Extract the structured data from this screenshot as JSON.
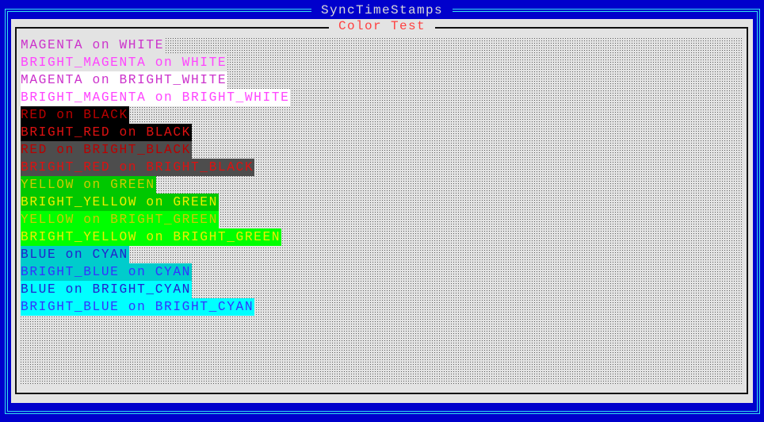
{
  "window": {
    "title": "SyncTimeStamps",
    "colors": {
      "background": "#0000CC",
      "border": "#33E0F0",
      "title_text": "#D8D8D8"
    }
  },
  "panel": {
    "title": "Color Test",
    "colors": {
      "background": "#E3E3E3",
      "frame": "#111111",
      "title_text": "#FF4040",
      "pattern_dot": "#5A5A5A"
    }
  },
  "color_rows": [
    {
      "label": "MAGENTA on WHITE",
      "fg": "#CC33CC",
      "bg": "#E3E3E3"
    },
    {
      "label": "BRIGHT_MAGENTA on WHITE",
      "fg": "#FF44FF",
      "bg": "#E3E3E3"
    },
    {
      "label": "MAGENTA on BRIGHT_WHITE",
      "fg": "#CC33CC",
      "bg": "#FFFFFF"
    },
    {
      "label": "BRIGHT_MAGENTA on BRIGHT_WHITE",
      "fg": "#FF44FF",
      "bg": "#FFFFFF"
    },
    {
      "label": "RED on BLACK",
      "fg": "#BB0000",
      "bg": "#000000"
    },
    {
      "label": "BRIGHT_RED on BLACK",
      "fg": "#DD1111",
      "bg": "#000000"
    },
    {
      "label": "RED on BRIGHT_BLACK",
      "fg": "#BB0000",
      "bg": "#4D4D4D"
    },
    {
      "label": "BRIGHT_RED on BRIGHT_BLACK",
      "fg": "#DD1111",
      "bg": "#4D4D4D"
    },
    {
      "label": "YELLOW on GREEN",
      "fg": "#CCCC00",
      "bg": "#00C800"
    },
    {
      "label": "BRIGHT_YELLOW on GREEN",
      "fg": "#EEEE00",
      "bg": "#00C800"
    },
    {
      "label": "YELLOW on BRIGHT_GREEN",
      "fg": "#CCCC00",
      "bg": "#00FF00"
    },
    {
      "label": "BRIGHT_YELLOW on BRIGHT_GREEN",
      "fg": "#EEEE00",
      "bg": "#00FF00"
    },
    {
      "label": "BLUE on CYAN",
      "fg": "#2222CC",
      "bg": "#00CCCC"
    },
    {
      "label": "BRIGHT_BLUE on CYAN",
      "fg": "#3333FF",
      "bg": "#00CCCC"
    },
    {
      "label": "BLUE on BRIGHT_CYAN",
      "fg": "#2222CC",
      "bg": "#00FFFF"
    },
    {
      "label": "BRIGHT_BLUE on BRIGHT_CYAN",
      "fg": "#3333FF",
      "bg": "#00FFFF"
    }
  ]
}
